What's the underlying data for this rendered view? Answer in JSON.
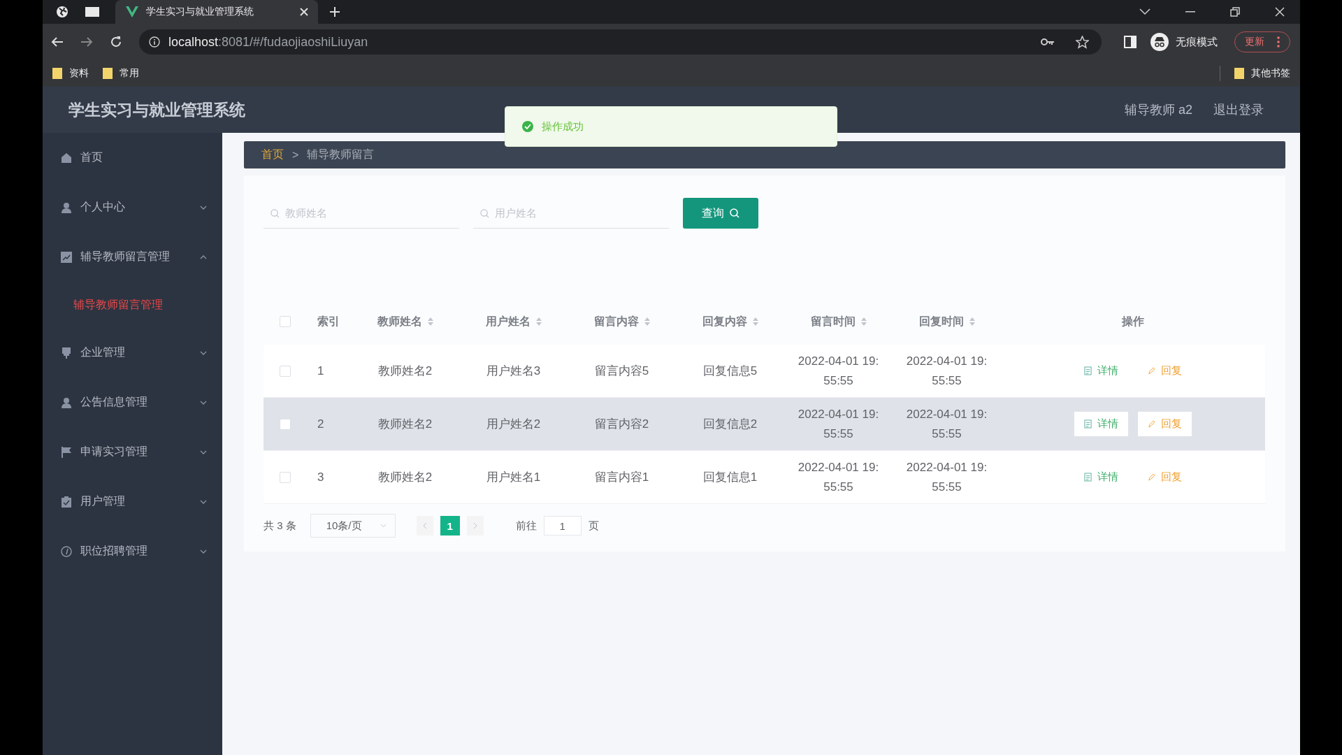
{
  "browser": {
    "tab_title": "学生实习与就业管理系统",
    "url_host": "localhost",
    "url_path": ":8081/#/fudaojiaoshiLiuyan",
    "profile_label": "无痕模式",
    "update_button": "更新",
    "bookmarks": [
      "资料",
      "常用"
    ],
    "other_bookmarks": "其他书签"
  },
  "app": {
    "title": "学生实习与就业管理系统",
    "user": "辅导教师 a2",
    "logout": "退出登录"
  },
  "toast": {
    "message": "操作成功"
  },
  "sidebar": {
    "items": [
      {
        "label": "首页",
        "kind": "link"
      },
      {
        "label": "个人中心",
        "kind": "submenu",
        "expanded": false
      },
      {
        "label": "辅导教师留言管理",
        "kind": "submenu",
        "expanded": true,
        "children": [
          {
            "label": "辅导教师留言管理",
            "selected": true
          }
        ]
      },
      {
        "label": "企业管理",
        "kind": "submenu",
        "expanded": false
      },
      {
        "label": "公告信息管理",
        "kind": "submenu",
        "expanded": false
      },
      {
        "label": "申请实习管理",
        "kind": "submenu",
        "expanded": false
      },
      {
        "label": "用户管理",
        "kind": "submenu",
        "expanded": false
      },
      {
        "label": "职位招聘管理",
        "kind": "submenu",
        "expanded": false
      }
    ]
  },
  "breadcrumb": {
    "home": "首页",
    "separator": ">",
    "current": "辅导教师留言"
  },
  "search": {
    "fields": [
      {
        "placeholder": "教师姓名"
      },
      {
        "placeholder": "用户姓名"
      }
    ],
    "button": "查询"
  },
  "table": {
    "select_all_checked": false,
    "columns": [
      {
        "label": "索引",
        "sortable": false
      },
      {
        "label": "教师姓名",
        "sortable": true
      },
      {
        "label": "用户姓名",
        "sortable": true
      },
      {
        "label": "留言内容",
        "sortable": true
      },
      {
        "label": "回复内容",
        "sortable": true
      },
      {
        "label": "留言时间",
        "sortable": true
      },
      {
        "label": "回复时间",
        "sortable": true
      },
      {
        "label": "操作",
        "sortable": false
      }
    ],
    "rows": [
      {
        "checked": false,
        "highlighted": false,
        "cells": [
          "1",
          "教师姓名2",
          "用户姓名3",
          "留言内容5",
          "回复信息5",
          "2022-04-01 19:55:55",
          "2022-04-01 19:55:55"
        ],
        "actions": [
          "详情",
          "回复"
        ]
      },
      {
        "checked": false,
        "highlighted": true,
        "cells": [
          "2",
          "教师姓名2",
          "用户姓名2",
          "留言内容2",
          "回复信息2",
          "2022-04-01 19:55:55",
          "2022-04-01 19:55:55"
        ],
        "actions": [
          "详情",
          "回复"
        ]
      },
      {
        "checked": false,
        "highlighted": false,
        "cells": [
          "3",
          "教师姓名2",
          "用户姓名1",
          "留言内容1",
          "回复信息1",
          "2022-04-01 19:55:55",
          "2022-04-01 19:55:55"
        ],
        "actions": [
          "详情",
          "回复"
        ]
      }
    ]
  },
  "pagination": {
    "total": "共 3 条",
    "page_size": "10条/页",
    "pages": [
      {
        "label": "1",
        "selected": true
      }
    ],
    "goto_label": "前往",
    "goto_value": "1",
    "page_unit": "页"
  }
}
